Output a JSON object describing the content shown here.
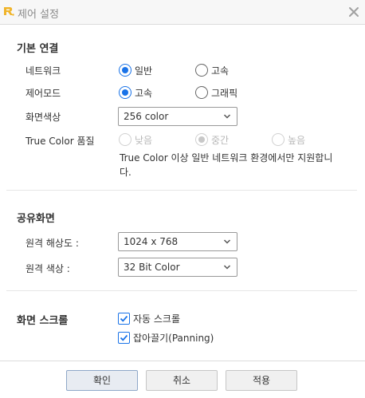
{
  "window": {
    "title": "제어 설정",
    "logo_icon": "rc-logo-icon",
    "close_icon": "close-icon"
  },
  "basic": {
    "title": "기본 연결",
    "network": {
      "label": "네트워크",
      "options": [
        "일반",
        "고속"
      ],
      "selected": "일반"
    },
    "control_mode": {
      "label": "제어모드",
      "options": [
        "고속",
        "그래픽"
      ],
      "selected": "고속"
    },
    "screen_color": {
      "label": "화면색상",
      "value": "256 color"
    },
    "true_color": {
      "label": "True Color 품질",
      "options": [
        "낮음",
        "중간",
        "높음"
      ],
      "selected": "중간",
      "disabled": true
    },
    "note": "True Color 이상 일반 네트워크 환경에서만 지원합니다."
  },
  "shared": {
    "title": "공유화면",
    "resolution": {
      "label": "원격 해상도 :",
      "value": "1024 x 768"
    },
    "color": {
      "label": "원격 색상 :",
      "value": "32 Bit Color"
    }
  },
  "scroll": {
    "title": "화면 스크롤",
    "auto_scroll": {
      "label": "자동 스크롤",
      "checked": true
    },
    "panning": {
      "label": "잡아끌기(Panning)",
      "checked": true
    }
  },
  "footer": {
    "ok": "확인",
    "cancel": "취소",
    "apply": "적용"
  },
  "colors": {
    "accent": "#1a73e8",
    "logo": "#f0b429"
  }
}
